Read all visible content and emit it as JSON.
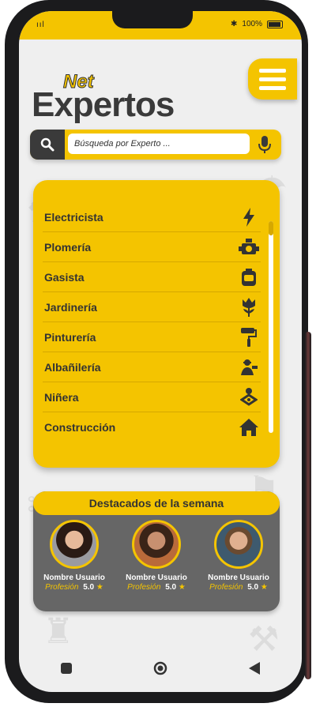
{
  "status_bar": {
    "signal": "ııl",
    "battery": "100%"
  },
  "brand": {
    "prefix": "Net",
    "name": "Expertos"
  },
  "search": {
    "placeholder": "Búsqueda por Experto ..."
  },
  "categories": [
    {
      "label": "Electricista",
      "icon": "lightning-icon"
    },
    {
      "label": "Plomería",
      "icon": "water-pump-icon"
    },
    {
      "label": "Gasista",
      "icon": "gas-cylinder-icon"
    },
    {
      "label": "Jardinería",
      "icon": "flower-icon"
    },
    {
      "label": "Pinturería",
      "icon": "paint-roller-icon"
    },
    {
      "label": "Albañilería",
      "icon": "bricklayer-icon"
    },
    {
      "label": "Niñera",
      "icon": "baby-icon"
    },
    {
      "label": "Construcción",
      "icon": "house-icon"
    }
  ],
  "featured": {
    "title": "Destacados de la semana",
    "experts": [
      {
        "name": "Nombre Usuario",
        "profession": "Profesión",
        "rating": "5.0"
      },
      {
        "name": "Nombre Usuario",
        "profession": "Profesión",
        "rating": "5.0"
      },
      {
        "name": "Nombre Usuario",
        "profession": "Profesión",
        "rating": "5.0"
      }
    ]
  },
  "colors": {
    "accent": "#f4c400",
    "dark": "#3a3a3a",
    "panel_dark": "#666666"
  }
}
